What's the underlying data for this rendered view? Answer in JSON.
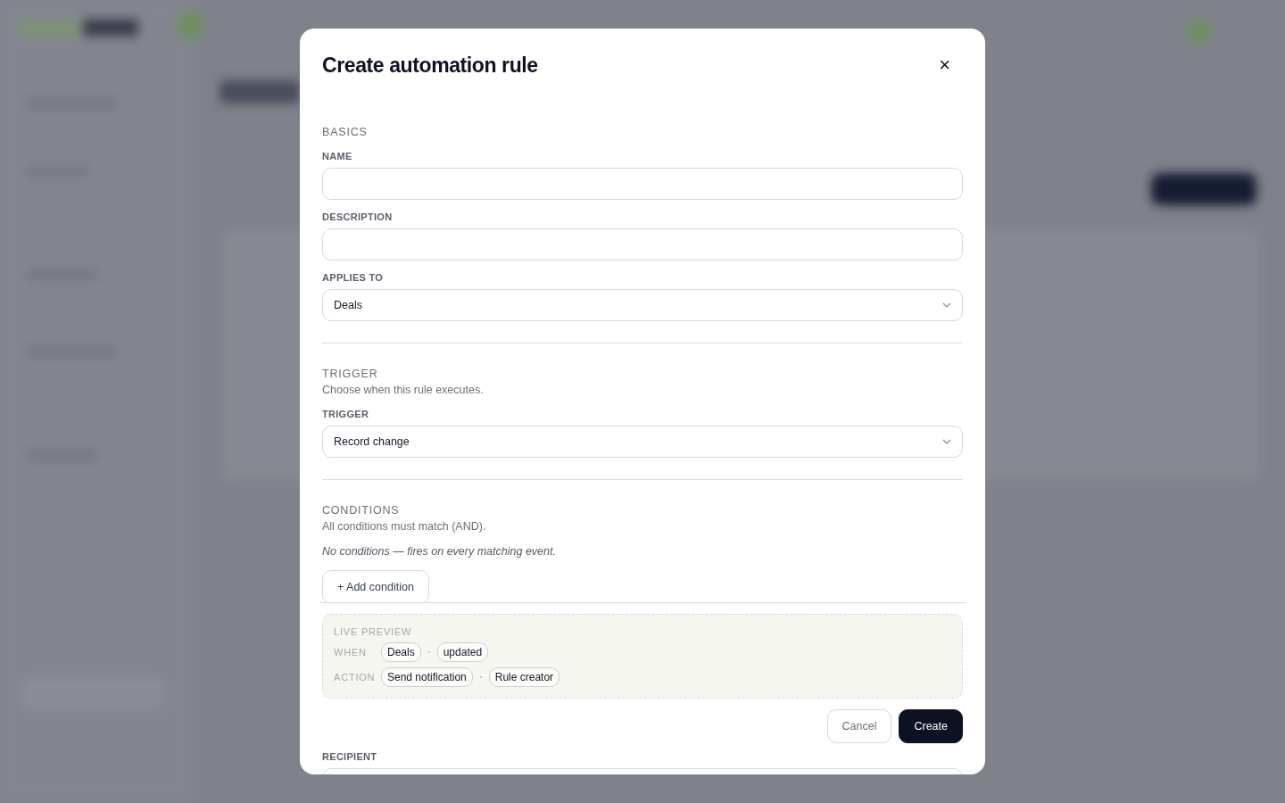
{
  "dialog": {
    "title": "Create automation rule",
    "close_label": "×"
  },
  "basics": {
    "heading": "BASICS",
    "fields": [
      {
        "kind": "text",
        "label": "NAME"
      },
      {
        "kind": "text",
        "label": "DESCRIPTION"
      },
      {
        "kind": "select",
        "label": "APPLIES TO",
        "value": "Deals"
      }
    ]
  },
  "trigger": {
    "heading": "TRIGGER",
    "description": "Choose when this rule executes.",
    "fields": [
      {
        "kind": "select",
        "label": "TRIGGER",
        "value": "Record change"
      }
    ]
  },
  "conditions": {
    "heading": "CONDITIONS",
    "description": "All conditions must match (AND).",
    "empty_note": "No conditions — fires on every matching event.",
    "add_button": "+ Add condition"
  },
  "live_preview": {
    "heading": "LIVE PREVIEW",
    "rows": [
      {
        "label": "WHEN",
        "chips": [
          "Deals",
          "updated"
        ]
      },
      {
        "label": "ACTION",
        "chips": [
          "Send notification",
          "Rule creator"
        ]
      }
    ]
  },
  "buttons": [
    {
      "kind": "secondary",
      "label": "Cancel"
    },
    {
      "kind": "primary",
      "label": "Create"
    }
  ],
  "next_field": {
    "label": "RECIPIENT"
  }
}
